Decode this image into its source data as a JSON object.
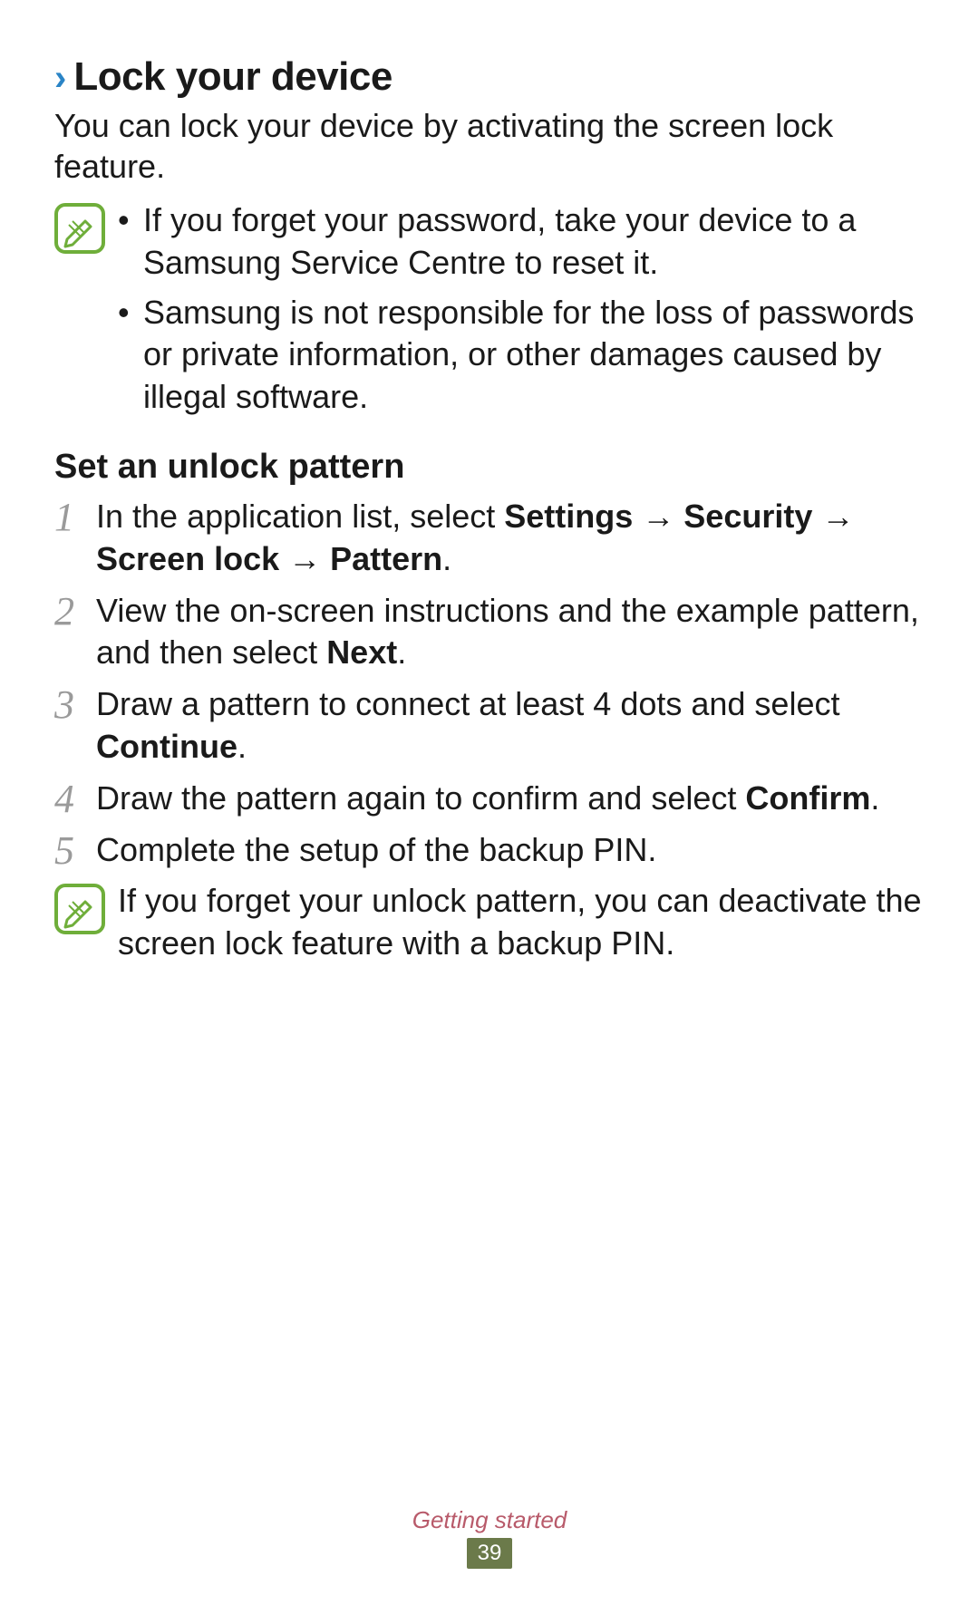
{
  "heading": {
    "chevron": "›",
    "title": "Lock your device"
  },
  "intro": "You can lock your device by activating the screen lock feature.",
  "note1": {
    "bullets": [
      "If you forget your password, take your device to a Samsung Service Centre to reset it.",
      "Samsung is not responsible for the loss of passwords or private information, or other damages caused by illegal software."
    ]
  },
  "subheading": "Set an unlock pattern",
  "steps": [
    {
      "num": "1",
      "parts": [
        {
          "t": "In the application list, select "
        },
        {
          "t": "Settings",
          "b": true
        },
        {
          "t": " → "
        },
        {
          "t": "Security",
          "b": true
        },
        {
          "t": " → "
        },
        {
          "t": "Screen lock",
          "b": true
        },
        {
          "t": " → "
        },
        {
          "t": "Pattern",
          "b": true
        },
        {
          "t": "."
        }
      ]
    },
    {
      "num": "2",
      "parts": [
        {
          "t": "View the on-screen instructions and the example pattern, and then select "
        },
        {
          "t": "Next",
          "b": true
        },
        {
          "t": "."
        }
      ]
    },
    {
      "num": "3",
      "parts": [
        {
          "t": "Draw a pattern to connect at least 4 dots and select "
        },
        {
          "t": "Continue",
          "b": true
        },
        {
          "t": "."
        }
      ]
    },
    {
      "num": "4",
      "parts": [
        {
          "t": "Draw the pattern again to confirm and select "
        },
        {
          "t": "Confirm",
          "b": true
        },
        {
          "t": "."
        }
      ]
    },
    {
      "num": "5",
      "parts": [
        {
          "t": "Complete the setup of the backup PIN."
        }
      ]
    }
  ],
  "note2": "If you forget your unlock pattern, you can deactivate the screen lock feature with a backup PIN.",
  "footer": {
    "section": "Getting started",
    "page": "39"
  }
}
